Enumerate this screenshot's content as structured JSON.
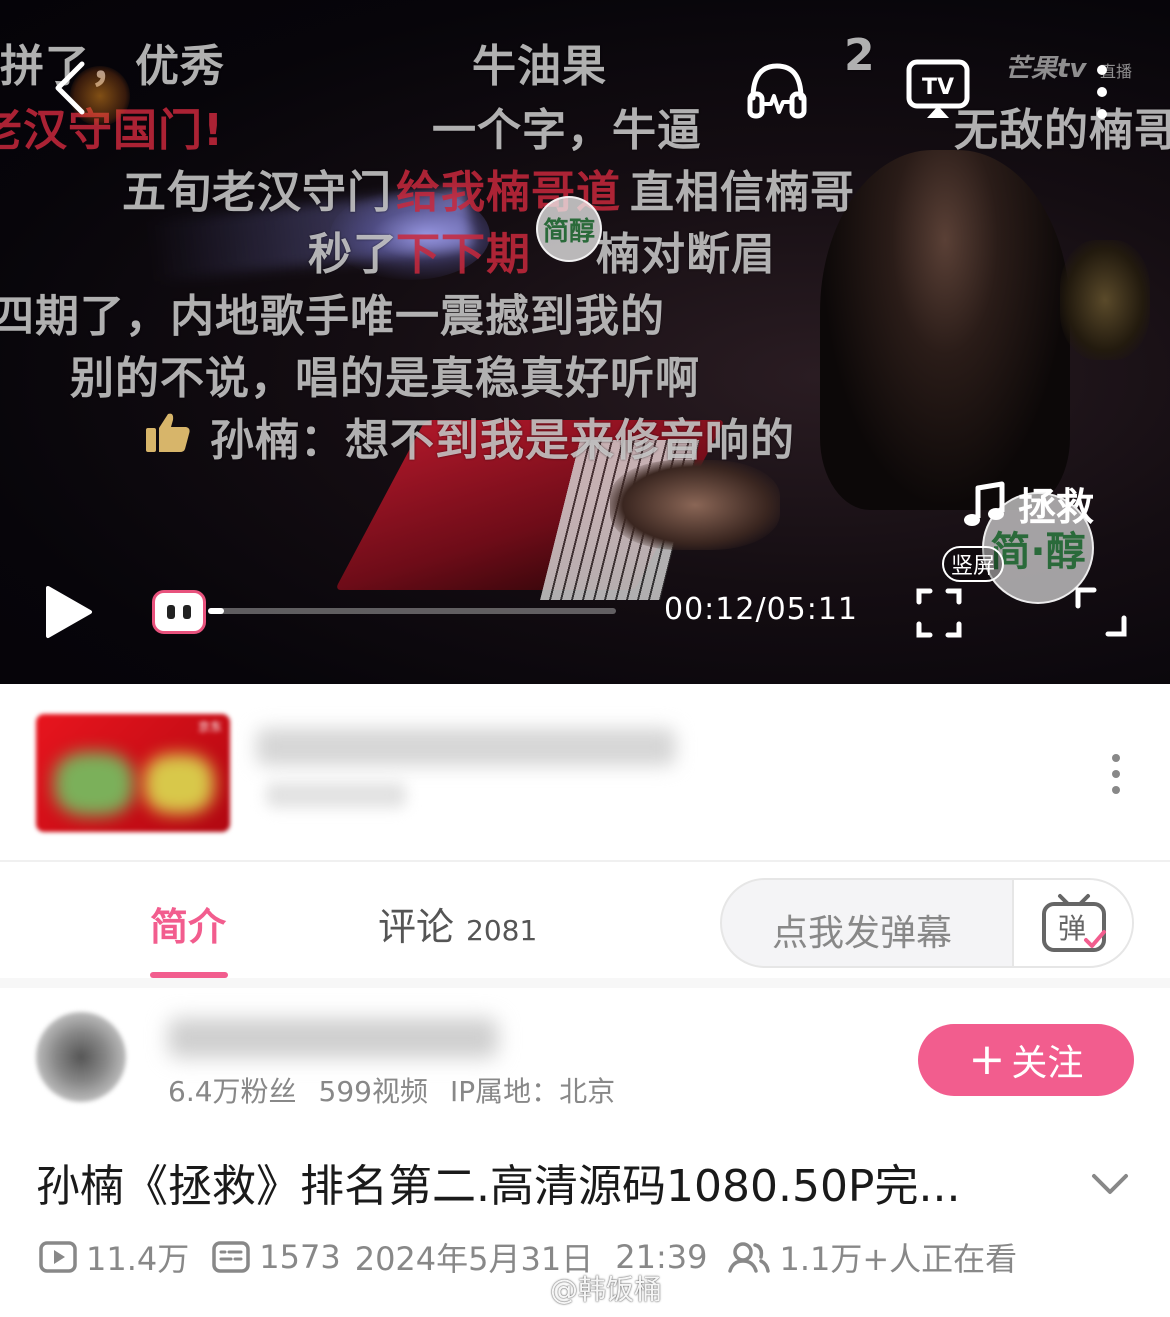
{
  "player": {
    "danmaku": [
      {
        "text": "拼了，优秀",
        "color": "white"
      },
      {
        "text": "牛油果",
        "color": "white"
      },
      {
        "text": "2",
        "color": "white"
      },
      {
        "text": "老汉守国门!",
        "color": "red"
      },
      {
        "text": "一个字，牛逼",
        "color": "white"
      },
      {
        "text": "无敌的楠哥",
        "color": "white"
      },
      {
        "text": "五旬老汉守门",
        "color": "white"
      },
      {
        "text": "给我楠哥道",
        "color": "red"
      },
      {
        "text": "直相信楠哥",
        "color": "white"
      },
      {
        "text": "秒了",
        "color": "white"
      },
      {
        "text": "下下期",
        "color": "red"
      },
      {
        "text": "楠对断眉",
        "color": "white"
      },
      {
        "text": "四期了，内地歌手唯一震撼到我的",
        "color": "white"
      },
      {
        "text": "别的不说，唱的是真稳真好听啊",
        "color": "white"
      },
      {
        "text": "孙楠：想不到我是来修音响的",
        "color": "white"
      }
    ],
    "channel_logo": "芒果tv",
    "live_tag": "直播",
    "watermark_small": "简醇",
    "watermark_large": "简·醇",
    "song_name": "拯救",
    "vertical_label": "竖屏",
    "time": "00:12/05:11",
    "progress": 0.0386,
    "accent": "#f25d8e"
  },
  "ad": {
    "jd_tag": "京东"
  },
  "tabs": {
    "intro": "简介",
    "comments": "评论",
    "comments_count": "2081",
    "danmaku_placeholder": "点我发弹幕",
    "danmaku_icon_text": "弹"
  },
  "uploader": {
    "fans": "6.4万粉丝",
    "videos": "599视频",
    "ip": "IP属地：北京",
    "follow_label": "关注"
  },
  "video": {
    "title": "孙楠《拯救》排名第二.高清源码1080.50P完...",
    "views": "11.4万",
    "danmaku_count": "1573",
    "date": "2024年5月31日",
    "time": "21:39",
    "watching": "1.1万+人正在看"
  },
  "watermark": "@韩饭桶"
}
